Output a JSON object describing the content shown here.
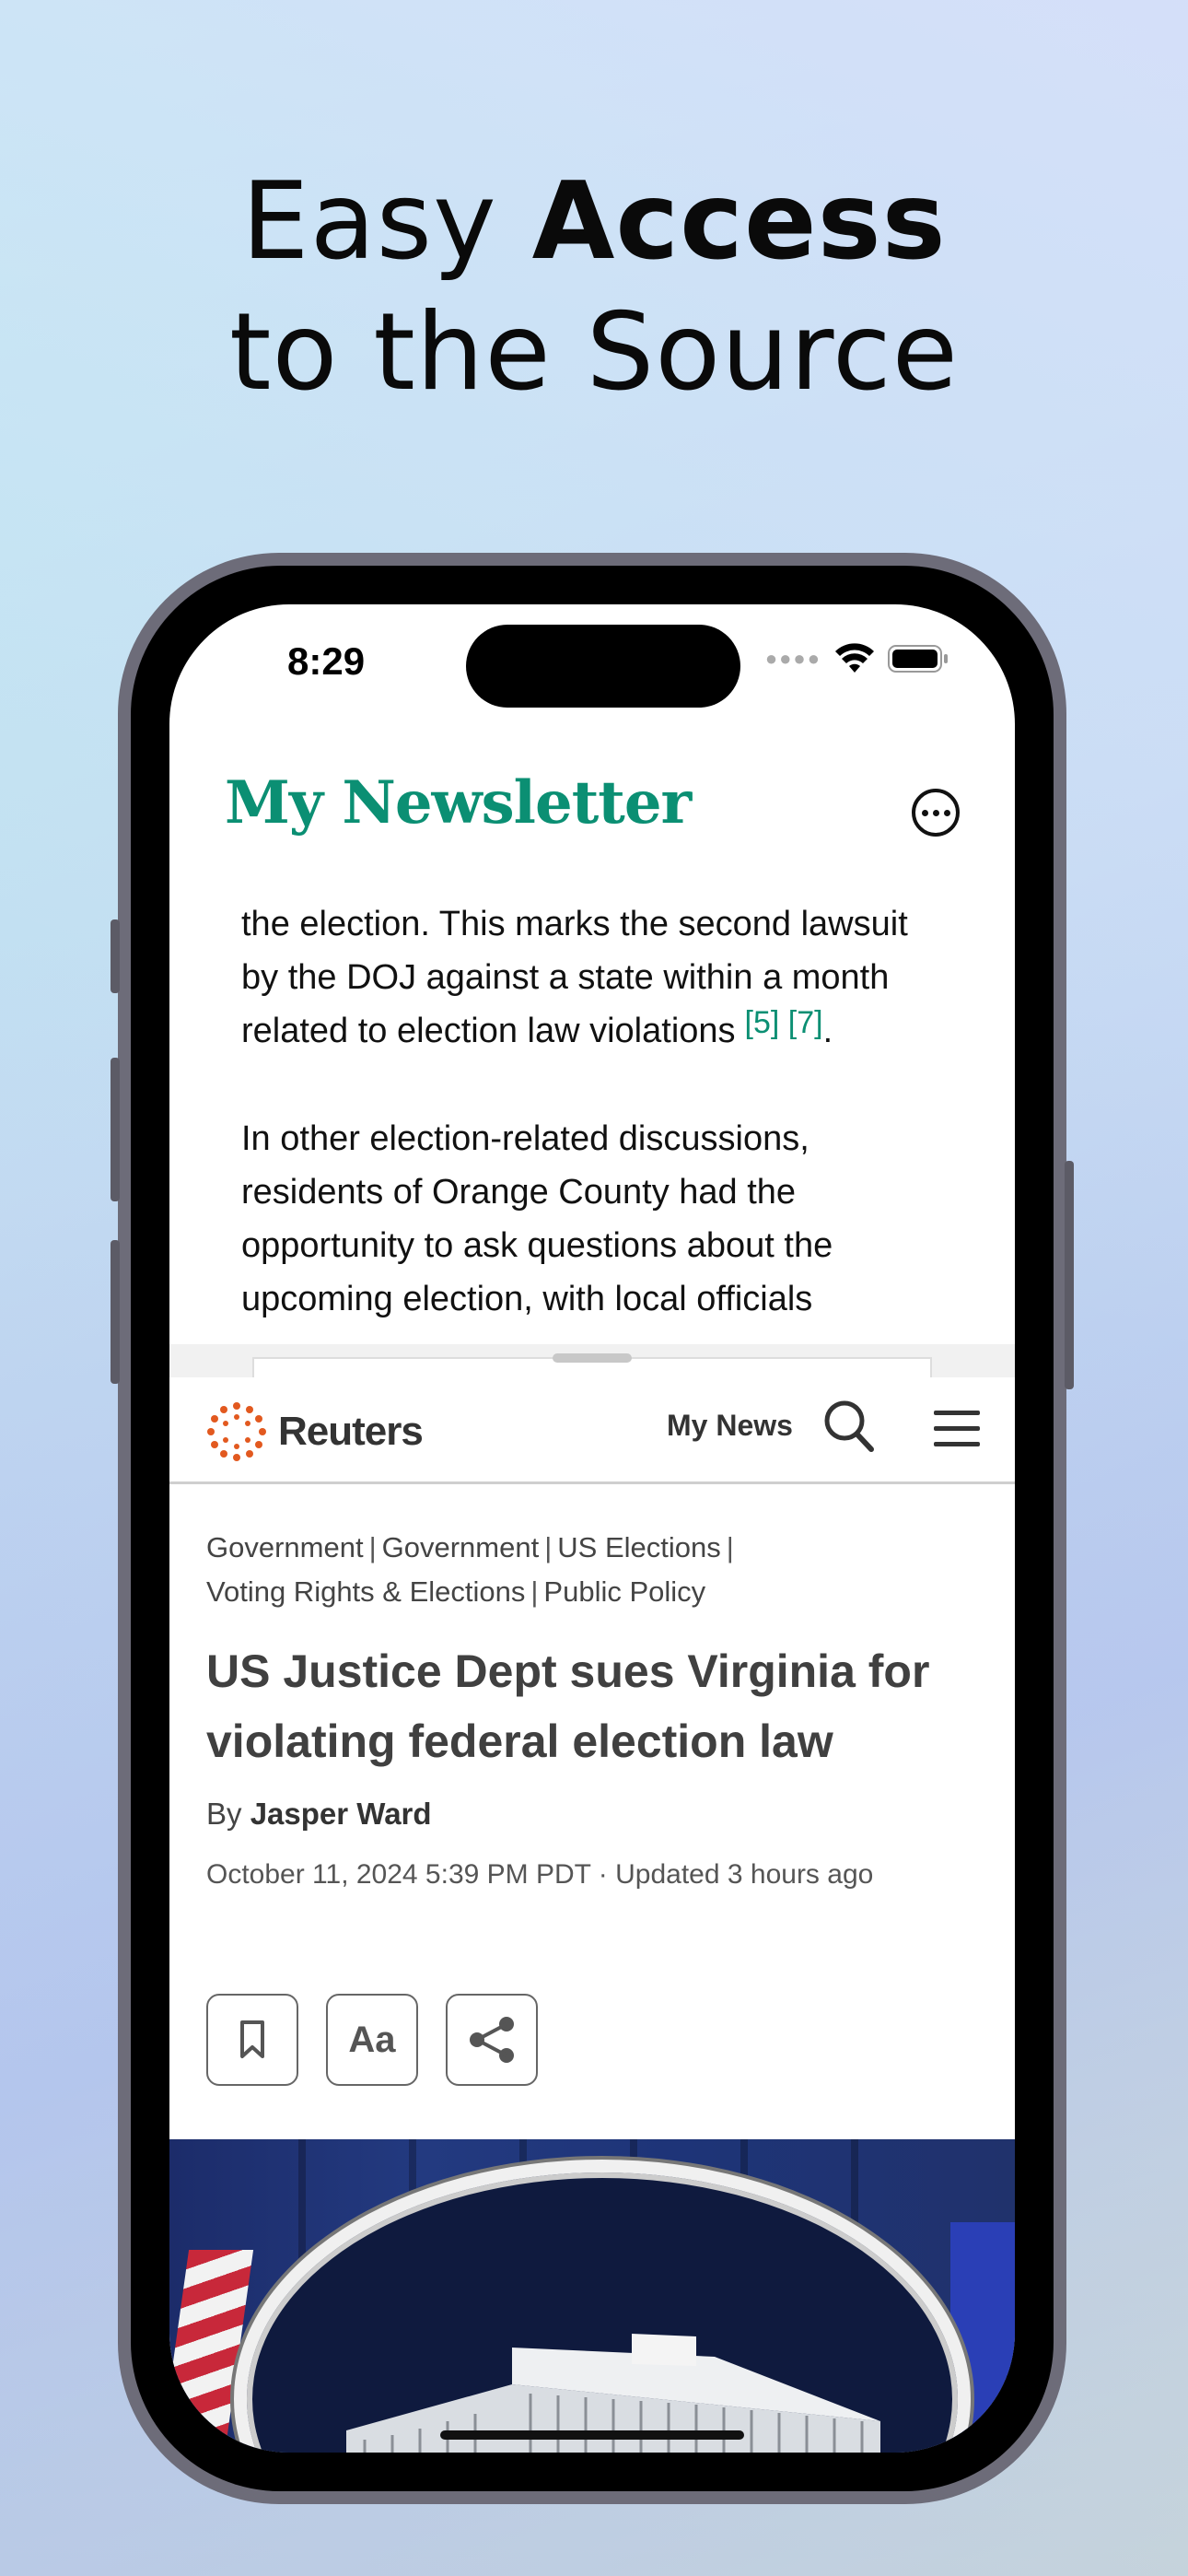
{
  "headline": {
    "line1_regular": "Easy ",
    "line1_bold": "Access",
    "line2": "to the Source"
  },
  "status_bar": {
    "time": "8:29",
    "icons": [
      "cellular-icon",
      "wifi-icon",
      "battery-icon"
    ]
  },
  "newsletter": {
    "title": "My Newsletter",
    "paragraphs": [
      {
        "lines": [
          "the election. This marks the second lawsuit",
          "by the DOJ against a state within a month",
          "related to election law violations"
        ],
        "citations": "[5] [7]",
        "end": "."
      },
      {
        "lines": [
          "In other election-related discussions,",
          "residents of Orange County had the",
          "opportunity to ask questions about the",
          "upcoming election, with local officials"
        ]
      }
    ],
    "accent_color": "#0b8f73"
  },
  "reuters": {
    "logo_text": "Reuters",
    "nav_my_news": "My News",
    "tags_line1": [
      "Government",
      "Government",
      "US Elections"
    ],
    "tags_line2": [
      "Voting Rights & Elections",
      "Public Policy"
    ],
    "title": "US Justice Dept sues Virginia for violating federal election law",
    "byline_prefix": "By",
    "author": "Jasper Ward",
    "dateline": "October 11, 2024 5:39 PM PDT · Updated 3 hours ago",
    "actions": {
      "bookmark": "bookmark-icon",
      "text_size_label": "Aa",
      "share": "share-icon"
    },
    "logo_color": "#e2591f"
  }
}
